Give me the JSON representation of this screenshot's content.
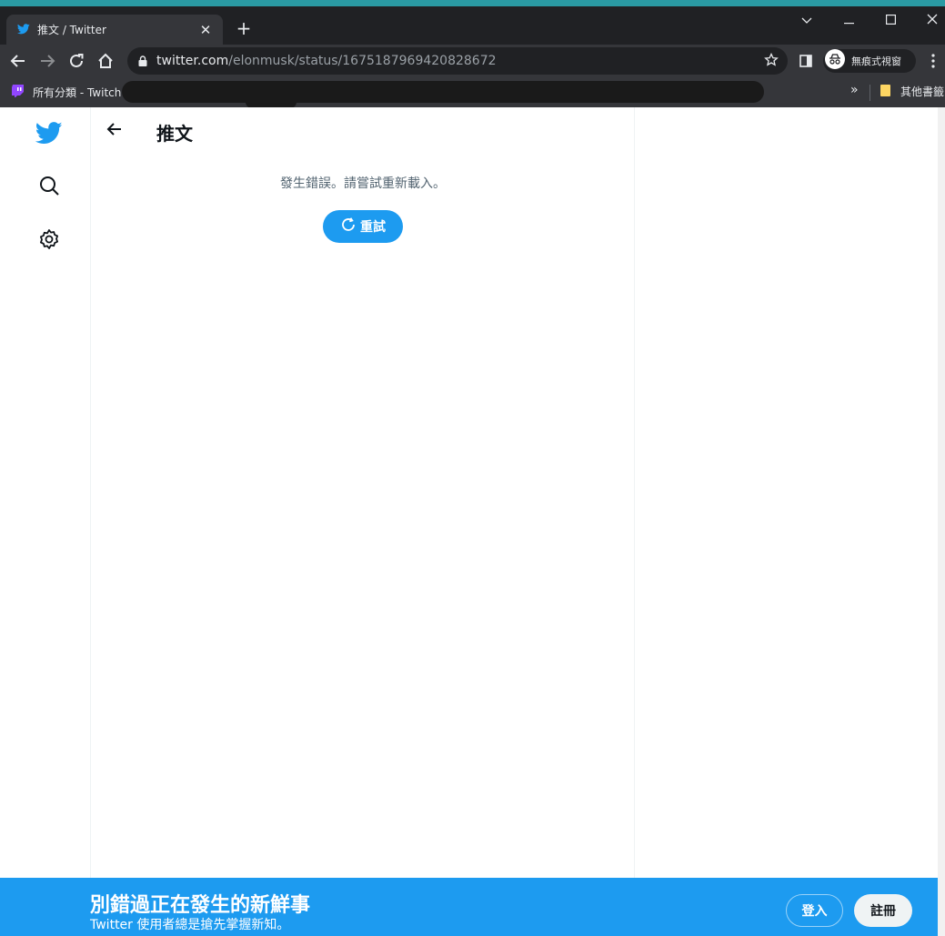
{
  "browser": {
    "tab_title": "推文 / Twitter",
    "tab_close": "✕",
    "new_tab": "+",
    "url_host": "twitter.com",
    "url_path": "/elonmusk/status/1675187969420828672",
    "incognito_label": "無痕式視窗",
    "bookmarks": {
      "twitch_label": "所有分類 - Twitch",
      "other_label": "其他書籤",
      "overflow": "»"
    },
    "window_controls": {
      "tablist": "⌵",
      "minimize": "—",
      "maximize": "☐",
      "close": "✕"
    }
  },
  "header": {
    "title": "推文"
  },
  "error": {
    "message": "發生錯誤。請嘗試重新載入。",
    "retry_label": "重試"
  },
  "banner": {
    "title": "別錯過正在發生的新鮮事",
    "subtitle": "Twitter 使用者總是搶先掌握新知。",
    "login_label": "登入",
    "signup_label": "註冊"
  },
  "colors": {
    "brand": "#1d9bf0",
    "chrome_dark": "#202124",
    "chrome_toolbar": "#35363a"
  }
}
